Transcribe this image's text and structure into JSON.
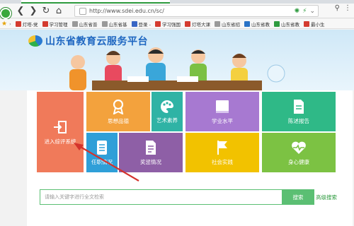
{
  "browser": {
    "url": "http://www.sdei.edu.cn/sc/",
    "colors": {
      "accent": "#2e9b3f"
    }
  },
  "bookmarks": [
    {
      "label": "灯塔-党",
      "color": "#d43b2f"
    },
    {
      "label": "学习管理",
      "color": "#d43b2f"
    },
    {
      "label": "山东省普",
      "color": "#999999"
    },
    {
      "label": "山东省基",
      "color": "#999999"
    },
    {
      "label": "登录 -",
      "color": "#3a66c4"
    },
    {
      "label": "学习强国",
      "color": "#d43b2f"
    },
    {
      "label": "灯塔大课",
      "color": "#d43b2f"
    },
    {
      "label": "山东省招",
      "color": "#999999"
    },
    {
      "label": "山东省教",
      "color": "#2a73c6"
    },
    {
      "label": "山东省教",
      "color": "#2e9b3f"
    },
    {
      "label": "最小生",
      "color": "#d43b2f"
    }
  ],
  "site": {
    "title": "山东省教育云服务平台"
  },
  "tiles": [
    {
      "label": "进入综评系统",
      "color": "#f07a5a",
      "icon": "login-door-icon"
    },
    {
      "label": "思想品德",
      "color": "#f3a23d",
      "icon": "medal-icon"
    },
    {
      "label": "艺术素养",
      "color": "#2fb3a5",
      "icon": "palette-icon"
    },
    {
      "label": "学业水平",
      "color": "#a779d1",
      "icon": "book-icon"
    },
    {
      "label": "陈述报告",
      "color": "#2fb987",
      "icon": "document-icon"
    },
    {
      "label": "任职情况",
      "color": "#2f9fd8",
      "icon": "id-card-icon"
    },
    {
      "label": "奖惩情况",
      "color": "#8e5fa6",
      "icon": "file-icon"
    },
    {
      "label": "社会实践",
      "color": "#f2c200",
      "icon": "flag-icon"
    },
    {
      "label": "身心健康",
      "color": "#7cc243",
      "icon": "heart-pulse-icon"
    }
  ],
  "search": {
    "placeholder": "请输入关键字进行全文检索",
    "button_label": "搜索",
    "advanced_label": "高级搜索"
  }
}
